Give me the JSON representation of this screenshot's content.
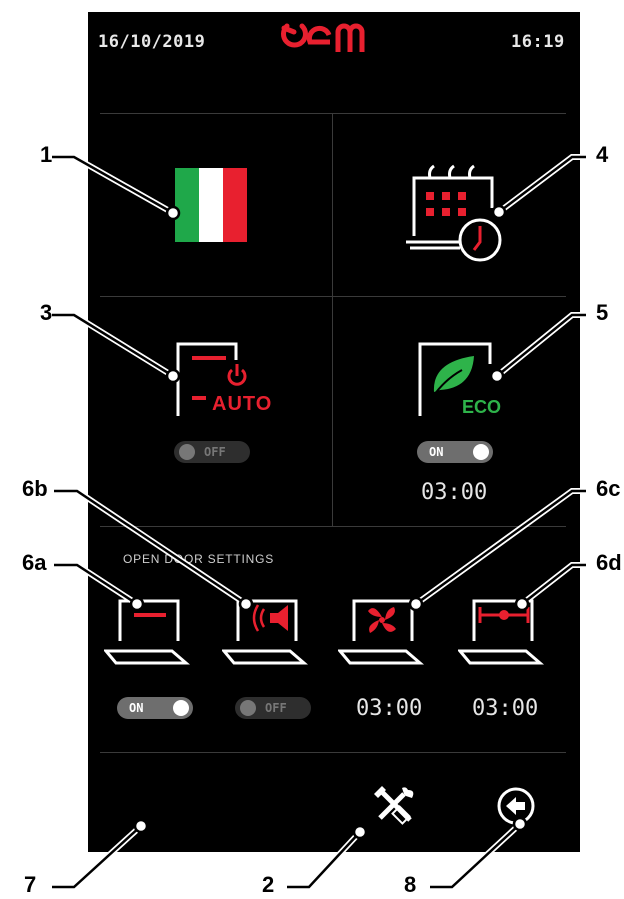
{
  "header": {
    "date": "16/10/2019",
    "time": "16:19",
    "brand": "oem"
  },
  "buttons": {
    "auto_label": "AUTO",
    "eco_label": "ECO",
    "auto_toggle": "OFF",
    "eco_toggle": "ON",
    "eco_timer": "03:00"
  },
  "door_settings": {
    "title": "OPEN DOOR SETTINGS",
    "toggle_6a": "ON",
    "toggle_6b": "OFF",
    "timer_6c": "03:00",
    "timer_6d": "03:00"
  },
  "callouts": {
    "c1": "1",
    "c2": "2",
    "c3": "3",
    "c4": "4",
    "c5": "5",
    "c6a": "6a",
    "c6b": "6b",
    "c6c": "6c",
    "c6d": "6d",
    "c7": "7",
    "c8": "8"
  },
  "colors": {
    "accent_red": "#e8202f",
    "eco_green": "#2eb34a",
    "screen_bg": "#000000"
  },
  "icons": [
    "italy-flag-icon",
    "calendar-clock-icon",
    "auto-power-icon",
    "eco-leaf-icon",
    "door-light-icon",
    "door-buzzer-icon",
    "door-fan-icon",
    "door-heater-icon",
    "tools-icon",
    "back-arrow-icon"
  ]
}
